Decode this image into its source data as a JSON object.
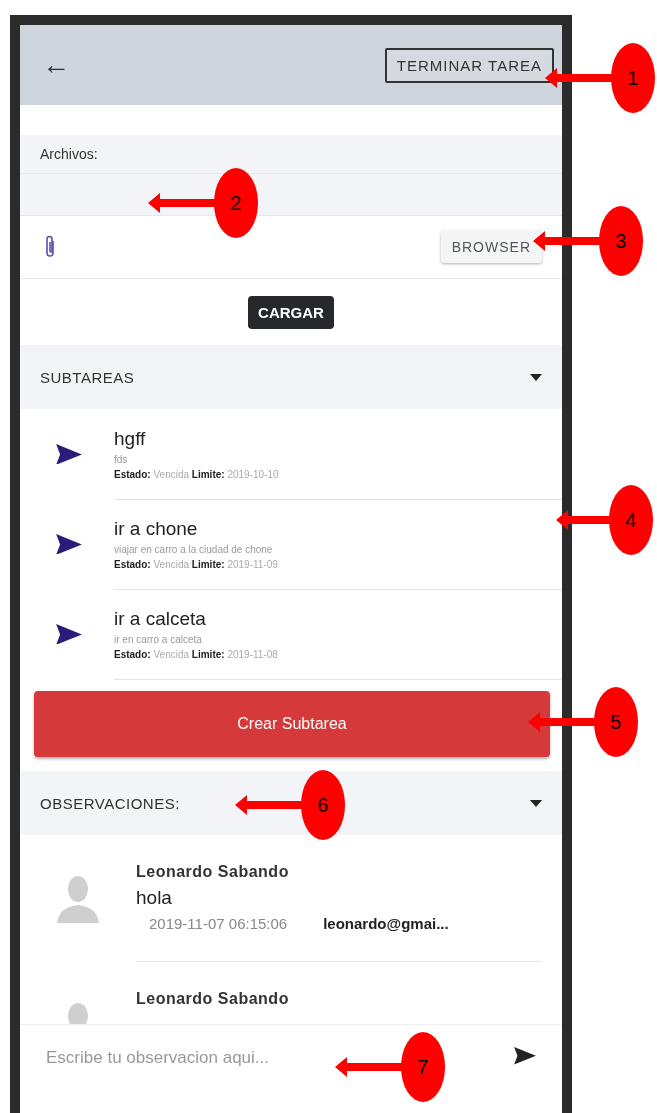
{
  "header": {
    "back": "←",
    "action": "TERMINAR TAREA"
  },
  "files": {
    "label": "Archivos:",
    "browse": "BROWSER",
    "upload": "CARGAR"
  },
  "subtasks": {
    "title": "SUBTAREAS",
    "expanded": true,
    "items": [
      {
        "title": "hgff",
        "description": "fds",
        "meta": "**Estado:** Vencida **Limite:** 2019-10-10"
      },
      {
        "title": "ir a chone",
        "description": "viajar en carro a la ciudad de chone",
        "meta": "**Estado:** Vencida **Limite:** 2019-11-09"
      },
      {
        "title": "ir a calceta",
        "description": "ir en carro a calceta",
        "meta": "**Estado:** Vencida **Limite:** 2019-11-08"
      }
    ],
    "create": "Crear Subtarea"
  },
  "observations": {
    "title": "OBSERVACIONES:",
    "expanded": true,
    "items": [
      {
        "author": "Leonardo Sabando",
        "text": "hola",
        "date": "2019-11-07 06:15:06",
        "email": "leonardo@gmai..."
      },
      {
        "author": "Leonardo Sabando"
      }
    ]
  },
  "composer": {
    "placeholder": "Escribe tu observacion aqui..."
  },
  "callouts": [
    {
      "number": "1"
    },
    {
      "number": "2"
    },
    {
      "number": "3"
    },
    {
      "number": "4"
    },
    {
      "number": "5"
    },
    {
      "number": "6"
    },
    {
      "number": "7"
    }
  ]
}
